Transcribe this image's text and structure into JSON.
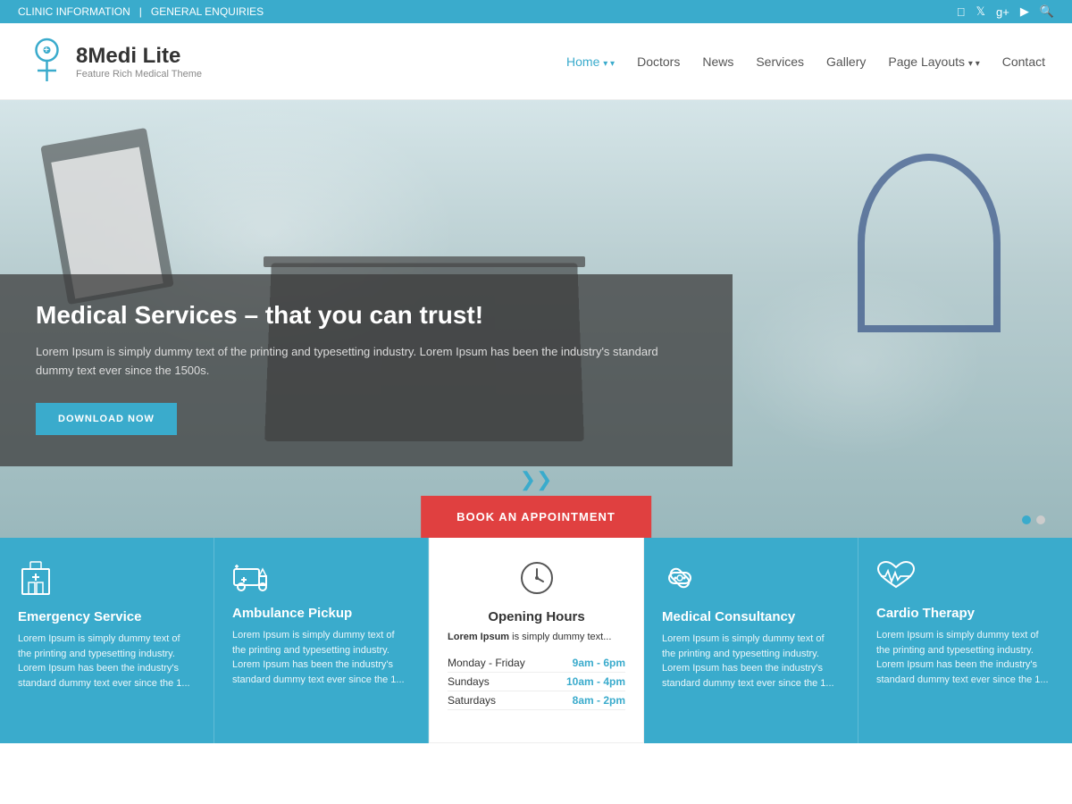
{
  "topbar": {
    "left_items": [
      "CLINIC INFORMATION",
      "|",
      "GENERAL ENQUIRIES"
    ],
    "social_icons": [
      "facebook",
      "twitter",
      "google-plus",
      "youtube",
      "search"
    ]
  },
  "header": {
    "logo_name": "8Medi Lite",
    "logo_tagline": "Feature Rich Medical Theme",
    "nav_items": [
      {
        "label": "Home",
        "active": true,
        "dropdown": true
      },
      {
        "label": "Doctors",
        "active": false,
        "dropdown": false
      },
      {
        "label": "News",
        "active": false,
        "dropdown": false
      },
      {
        "label": "Services",
        "active": false,
        "dropdown": false
      },
      {
        "label": "Gallery",
        "active": false,
        "dropdown": false
      },
      {
        "label": "Page Layouts",
        "active": false,
        "dropdown": true
      },
      {
        "label": "Contact",
        "active": false,
        "dropdown": false
      }
    ]
  },
  "hero": {
    "title": "Medical Services – that you can trust!",
    "description": "Lorem Ipsum is simply dummy text of the printing and typesetting industry. Lorem Ipsum has been the industry's standard dummy text ever since the 1500s.",
    "cta_button": "DOWNLOAD NOW",
    "book_button": "BOOK AN APPOINTMENT"
  },
  "services": [
    {
      "icon": "hospital",
      "title": "Emergency Service",
      "desc": "Lorem Ipsum is simply dummy text of the printing and typesetting industry. Lorem Ipsum has been the industry's standard dummy text ever since the 1...",
      "white": false
    },
    {
      "icon": "ambulance",
      "title": "Ambulance Pickup",
      "desc": "Lorem Ipsum is simply dummy text of the printing and typesetting industry. Lorem Ipsum has been the industry's standard dummy text ever since the 1...",
      "white": false
    },
    {
      "icon": "clock",
      "title": "Opening Hours",
      "intro_bold": "Lorem Ipsum",
      "intro_rest": " is simply dummy text...",
      "hours": [
        {
          "day": "Monday - Friday",
          "time": "9am - 6pm"
        },
        {
          "day": "Sundays",
          "time": "10am - 4pm"
        },
        {
          "day": "Saturdays",
          "time": "8am - 2pm"
        }
      ],
      "white": true
    },
    {
      "icon": "bandage",
      "title": "Medical Consultancy",
      "desc": "Lorem Ipsum is simply dummy text of the printing and typesetting industry. Lorem Ipsum has been the industry's standard dummy text ever since the 1...",
      "white": false
    },
    {
      "icon": "heartbeat",
      "title": "Cardio Therapy",
      "desc": "Lorem Ipsum is simply dummy text of the printing and typesetting industry. Lorem Ipsum has been the industry's standard dummy text ever since the 1...",
      "white": false
    }
  ]
}
